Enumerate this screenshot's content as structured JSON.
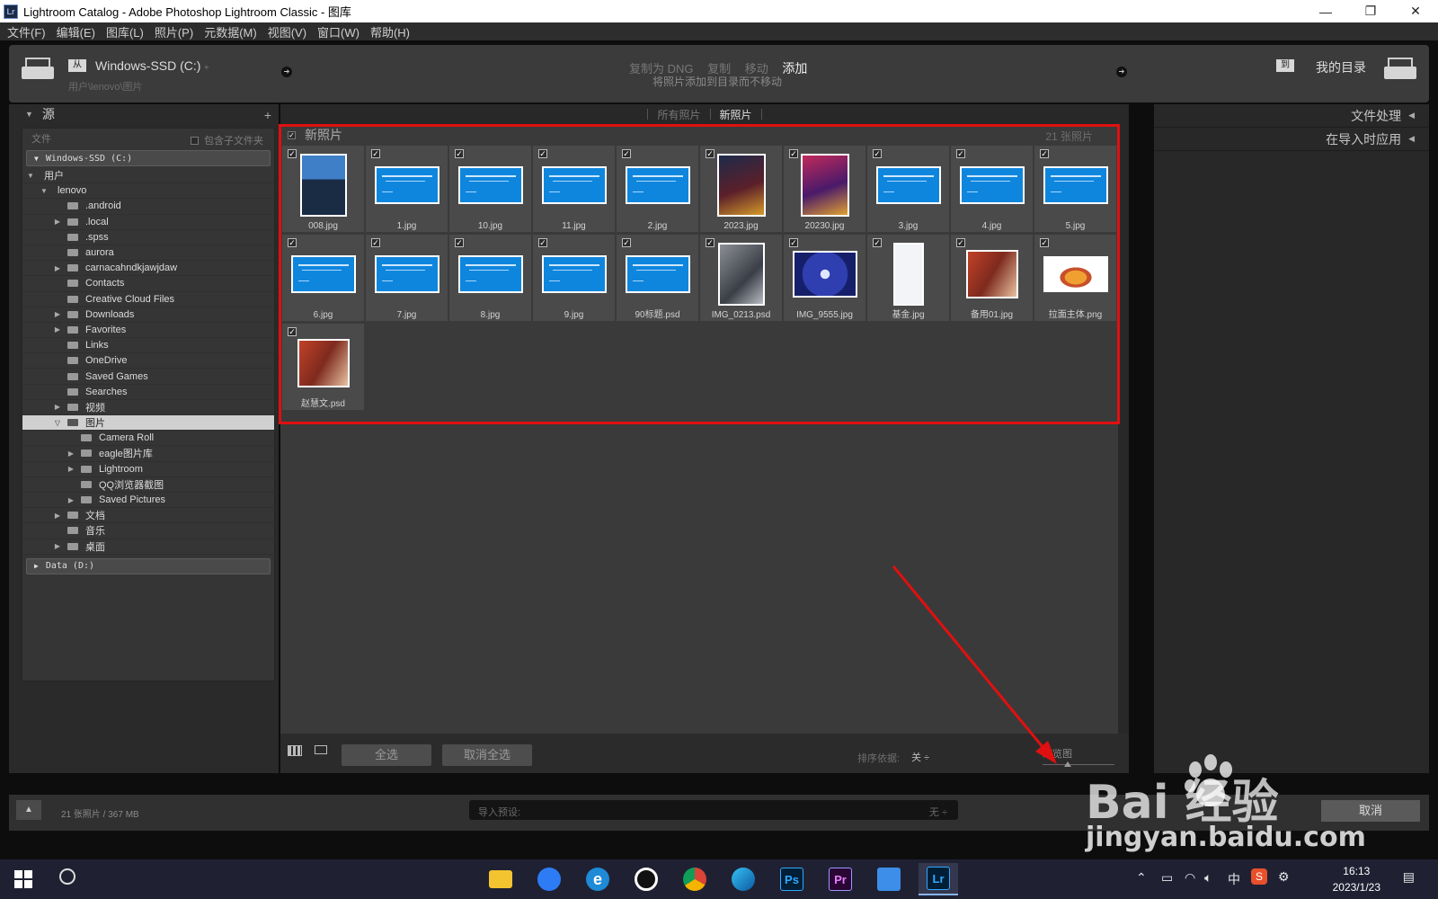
{
  "window": {
    "app_icon": "Lr",
    "title": "Lightroom Catalog - Adobe Photoshop Lightroom Classic - 图库",
    "controls": [
      "minimize-icon",
      "restore-icon",
      "close-icon"
    ]
  },
  "menu": [
    "文件(F)",
    "编辑(E)",
    "图库(L)",
    "照片(P)",
    "元数据(M)",
    "视图(V)",
    "窗口(W)",
    "帮助(H)"
  ],
  "topbar": {
    "from_badge": "从",
    "source_name": "Windows-SSD (C:)",
    "source_caret": "÷",
    "source_path": "用户\\lenovo\\图片",
    "modes": [
      "复制为 DNG",
      "复制",
      "移动",
      "添加"
    ],
    "active_mode": "添加",
    "mode_desc": "将照片添加到目录而不移动",
    "to_badge": "到",
    "dest_name": "我的目录"
  },
  "source_panel": {
    "title": "源",
    "add": "+",
    "files_label": "文件",
    "include_sub": "包含子文件夹",
    "drive_c": "Windows-SSD (C:)",
    "drive_d": "Data (D:)",
    "tree": [
      {
        "label": "用户",
        "level": 0,
        "tri": "▼",
        "folder": false
      },
      {
        "label": "lenovo",
        "level": 1,
        "tri": "▼",
        "folder": false
      },
      {
        "label": ".android",
        "level": 2,
        "tri": "",
        "folder": true
      },
      {
        "label": ".local",
        "level": 2,
        "tri": "▶",
        "folder": true
      },
      {
        "label": ".spss",
        "level": 2,
        "tri": "",
        "folder": true
      },
      {
        "label": "aurora",
        "level": 2,
        "tri": "",
        "folder": true
      },
      {
        "label": "carnacahndkjawjdaw",
        "level": 2,
        "tri": "▶",
        "folder": true
      },
      {
        "label": "Contacts",
        "level": 2,
        "tri": "",
        "folder": true
      },
      {
        "label": "Creative Cloud Files",
        "level": 2,
        "tri": "",
        "folder": true
      },
      {
        "label": "Downloads",
        "level": 2,
        "tri": "▶",
        "folder": true
      },
      {
        "label": "Favorites",
        "level": 2,
        "tri": "▶",
        "folder": true
      },
      {
        "label": "Links",
        "level": 2,
        "tri": "",
        "folder": true
      },
      {
        "label": "OneDrive",
        "level": 2,
        "tri": "",
        "folder": true
      },
      {
        "label": "Saved Games",
        "level": 2,
        "tri": "",
        "folder": true
      },
      {
        "label": "Searches",
        "level": 2,
        "tri": "",
        "folder": true
      },
      {
        "label": "视频",
        "level": 2,
        "tri": "▶",
        "folder": true
      },
      {
        "label": "图片",
        "level": 2,
        "tri": "▽",
        "folder": true,
        "selected": true
      },
      {
        "label": "Camera Roll",
        "level": 3,
        "tri": "",
        "folder": true
      },
      {
        "label": "eagle图片库",
        "level": 3,
        "tri": "▶",
        "folder": true
      },
      {
        "label": "Lightroom",
        "level": 3,
        "tri": "▶",
        "folder": true
      },
      {
        "label": "QQ浏览器截图",
        "level": 3,
        "tri": "",
        "folder": true
      },
      {
        "label": "Saved Pictures",
        "level": 3,
        "tri": "▶",
        "folder": true
      },
      {
        "label": "文档",
        "level": 2,
        "tri": "▶",
        "folder": true
      },
      {
        "label": "音乐",
        "level": 2,
        "tri": "",
        "folder": true
      },
      {
        "label": "桌面",
        "level": 2,
        "tri": "▶",
        "folder": true
      }
    ]
  },
  "grid": {
    "tabs": [
      "所有照片",
      "新照片"
    ],
    "active_tab": "新照片",
    "header": "新照片",
    "count": "21 张照片",
    "photos": [
      {
        "name": "008.jpg",
        "kind": "portrait"
      },
      {
        "name": "1.jpg",
        "kind": "slide"
      },
      {
        "name": "10.jpg",
        "kind": "slide"
      },
      {
        "name": "11.jpg",
        "kind": "slide"
      },
      {
        "name": "2.jpg",
        "kind": "slide"
      },
      {
        "name": "2023.jpg",
        "kind": "newyear"
      },
      {
        "name": "20230.jpg",
        "kind": "newyear2"
      },
      {
        "name": "3.jpg",
        "kind": "slide"
      },
      {
        "name": "4.jpg",
        "kind": "slide"
      },
      {
        "name": "5.jpg",
        "kind": "slide"
      },
      {
        "name": "6.jpg",
        "kind": "slide"
      },
      {
        "name": "7.jpg",
        "kind": "slide"
      },
      {
        "name": "8.jpg",
        "kind": "slide"
      },
      {
        "name": "9.jpg",
        "kind": "slide"
      },
      {
        "name": "90标题.psd",
        "kind": "slide"
      },
      {
        "name": "IMG_0213.psd",
        "kind": "photo"
      },
      {
        "name": "IMG_9555.jpg",
        "kind": "dance"
      },
      {
        "name": "基金.jpg",
        "kind": "phone"
      },
      {
        "name": "备用01.jpg",
        "kind": "girl"
      },
      {
        "name": "拉面主体.png",
        "kind": "noodle"
      },
      {
        "name": "赵慧文.psd",
        "kind": "girl"
      }
    ],
    "check_all": "全选",
    "uncheck_all": "取消全选",
    "sort_label": "排序依据:",
    "sort_value": "关 ÷",
    "thumb_size_label": "缩览图"
  },
  "right_panel": {
    "items": [
      "文件处理",
      "在导入时应用"
    ]
  },
  "footer": {
    "info": "21 张照片 / 367 MB",
    "preset_label": "导入预设:",
    "preset_value": "无 ÷",
    "cancel": "取消"
  },
  "watermark": {
    "brand": "Bai  经验",
    "url": "jingyan.baidu.com"
  },
  "taskbar": {
    "apps": [
      "file-explorer-icon",
      "quark-browser-icon",
      "edge-legacy-icon",
      "qq-icon",
      "chrome-icon",
      "edge-icon",
      "ps-icon",
      "pr-icon",
      "notepad-icon",
      "lr-icon"
    ],
    "app_labels": {
      "ps": "Ps",
      "pr": "Pr",
      "lr": "Lr"
    },
    "ime": "中",
    "time": "16:13",
    "date": "2023/1/23"
  },
  "colors": {
    "accent_red": "#e01010",
    "slide_blue": "#0f86dd",
    "lr_blue": "#31a8ff"
  }
}
